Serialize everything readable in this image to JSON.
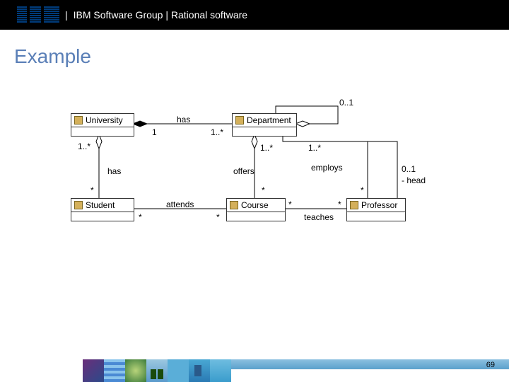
{
  "header": {
    "brand": "IBM",
    "divider": "|",
    "text": "IBM Software Group | Rational software"
  },
  "title": "Example",
  "classes": {
    "university": "University",
    "department": "Department",
    "student": "Student",
    "course": "Course",
    "professor": "Professor"
  },
  "assoc": {
    "has_dept": {
      "name": "has",
      "end_a": "1",
      "end_b": "1..*"
    },
    "dept_head": {
      "end_a": "0..1"
    },
    "has_student": {
      "name": "has",
      "end_a": "1..*",
      "end_b": "*"
    },
    "offers": {
      "name": "offers",
      "end_a": "1..*",
      "end_b": "*"
    },
    "employs": {
      "name": "employs",
      "end_a": "1..*",
      "end_b": "*",
      "head_mult": "0..1",
      "head_role": "- head"
    },
    "attends": {
      "name": "attends",
      "end_a": "*",
      "end_b": "*"
    },
    "teaches": {
      "name": "teaches",
      "end_a": "*",
      "end_b": "*"
    }
  },
  "footer": {
    "page_number": "69"
  }
}
